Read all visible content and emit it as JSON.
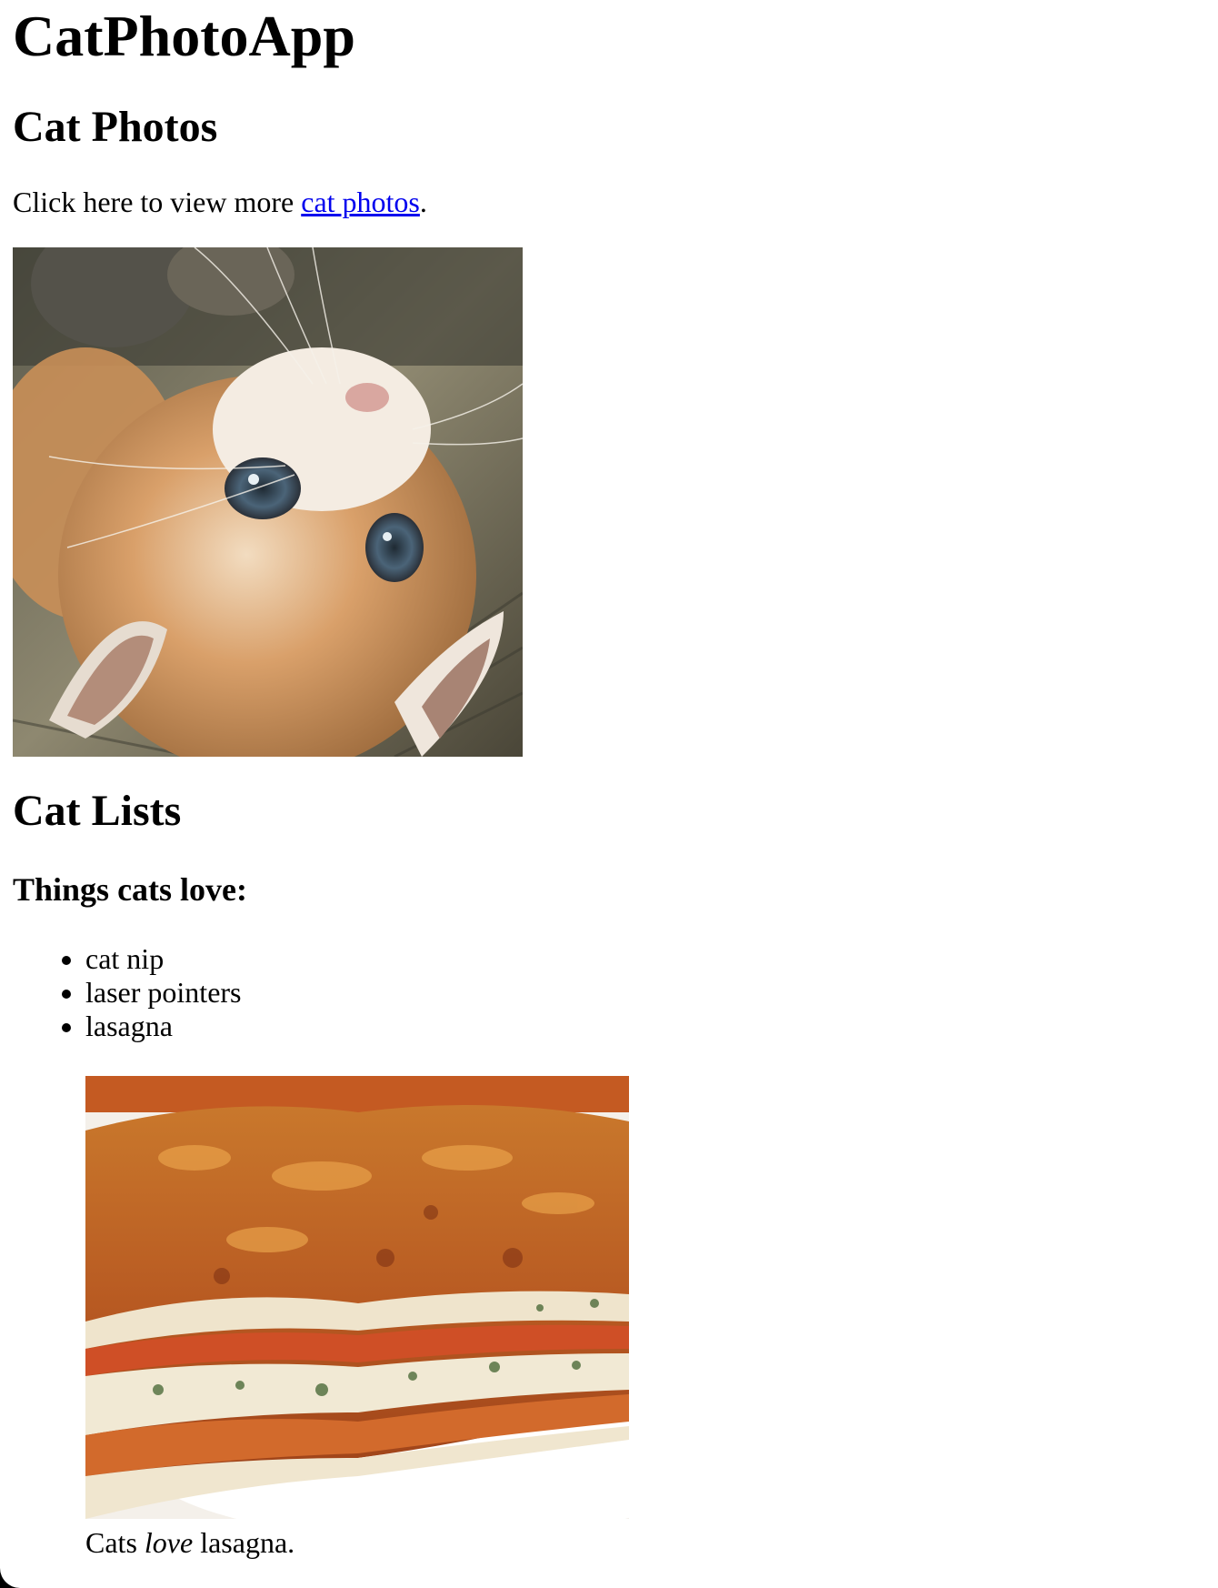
{
  "app_title": "CatPhotoApp",
  "photos_section": {
    "heading": "Cat Photos",
    "text_before_link": "Click here to view more ",
    "link_text": "cat photos",
    "text_after_link": "."
  },
  "lists_section": {
    "heading": "Cat Lists",
    "subheading": "Things cats love:",
    "items": [
      "cat nip",
      "laser pointers",
      "lasagna"
    ],
    "caption_before": "Cats ",
    "caption_emphasis": "love",
    "caption_after": " lasagna."
  },
  "colors": {
    "link": "#0000ee",
    "text": "#000000",
    "background": "#ffffff"
  }
}
